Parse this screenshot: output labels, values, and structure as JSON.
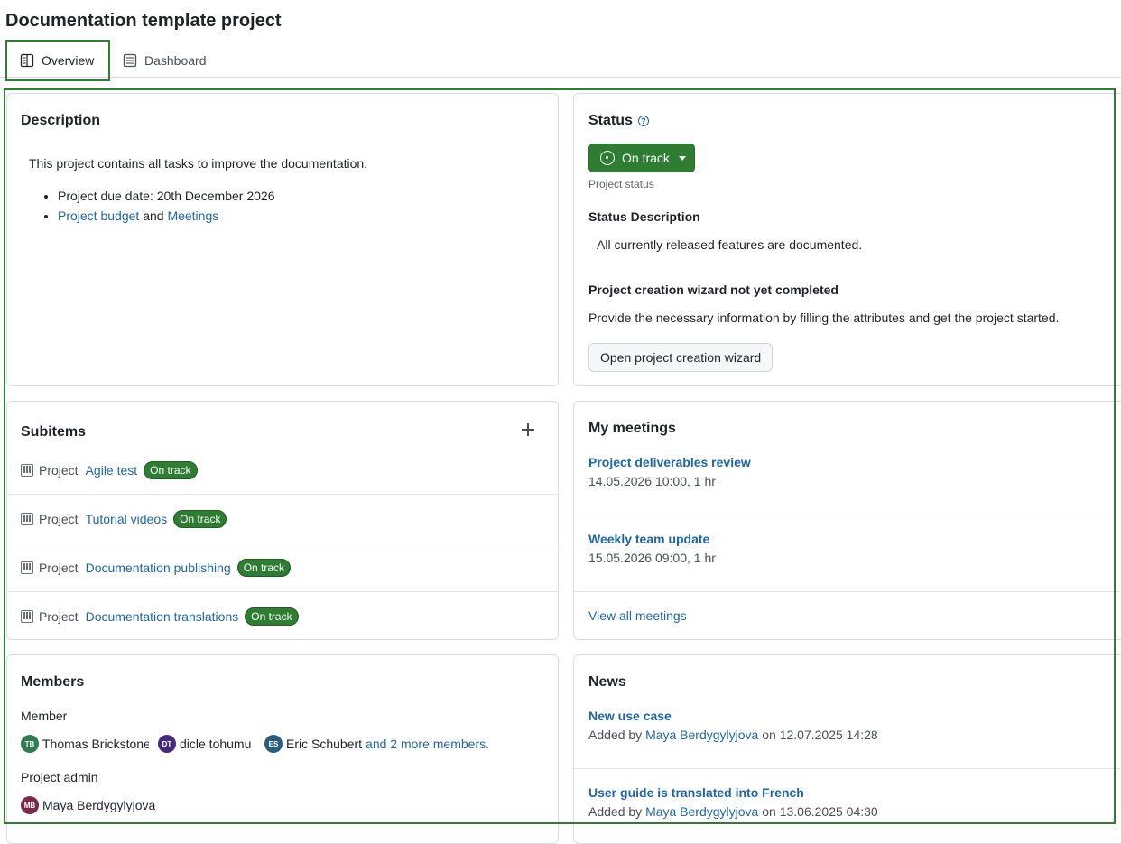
{
  "page": {
    "title": "Documentation template project"
  },
  "tabs": [
    {
      "label": "Overview",
      "icon": "overview-icon",
      "active": true
    },
    {
      "label": "Dashboard",
      "icon": "dashboard-icon",
      "active": false
    }
  ],
  "colors": {
    "accent_green": "#2e7d32",
    "link_blue": "#1f66a4",
    "border": "#d8dde3"
  },
  "description": {
    "title": "Description",
    "text": "This project contains all tasks to improve the documentation.",
    "bullet1": "Project due date: 20th December 2026",
    "bullet2_link1": "Project budget",
    "bullet2_and": "and",
    "bullet2_link2": "Meetings"
  },
  "status": {
    "title": "Status",
    "help_icon": "?",
    "value": "On track",
    "caption": "Project status",
    "desc_heading": "Status Description",
    "desc_text": "All currently released features are documented.",
    "wizard_heading": "Project creation wizard not yet completed",
    "wizard_text": "Provide the necessary information by filling the attributes and get the project started.",
    "wizard_button": "Open project creation wizard"
  },
  "subitems": {
    "title": "Subitems",
    "items": [
      {
        "type": "Project",
        "name": "Agile test",
        "status": "On track"
      },
      {
        "type": "Project",
        "name": "Tutorial videos",
        "status": "On track"
      },
      {
        "type": "Project",
        "name": "Documentation publishing",
        "status": "On track"
      },
      {
        "type": "Project",
        "name": "Documentation translations",
        "status": "On track"
      }
    ]
  },
  "meetings": {
    "title": "My meetings",
    "items": [
      {
        "title": "Project deliverables review",
        "time": "14.05.2026 10:00, 1 hr"
      },
      {
        "title": "Weekly team update",
        "time": "15.05.2026 09:00, 1 hr"
      }
    ],
    "view_all": "View all meetings"
  },
  "members": {
    "title": "Members",
    "roles": [
      {
        "label": "Member",
        "people": [
          {
            "initials": "TB",
            "name": "Thomas Brickstone",
            "color": "#2e7d4f"
          },
          {
            "initials": "DT",
            "name": "dicle tohumu",
            "color": "#4a2a7a"
          },
          {
            "initials": "ES",
            "name": "Eric Schubert",
            "color": "#2c5d7c"
          }
        ],
        "more": "and 2 more members."
      },
      {
        "label": "Project admin",
        "people": [
          {
            "initials": "MB",
            "name": "Maya Berdygylyjova",
            "color": "#7a2a4a"
          }
        ]
      }
    ]
  },
  "news": {
    "title": "News",
    "items": [
      {
        "title": "New use case",
        "added_by": "Added by",
        "author": "Maya Berdygylyjova",
        "on": "on 12.07.2025 14:28"
      },
      {
        "title": "User guide is translated into French",
        "added_by": "Added by",
        "author": "Maya Berdygylyjova",
        "on": "on 13.06.2025 04:30"
      }
    ]
  }
}
